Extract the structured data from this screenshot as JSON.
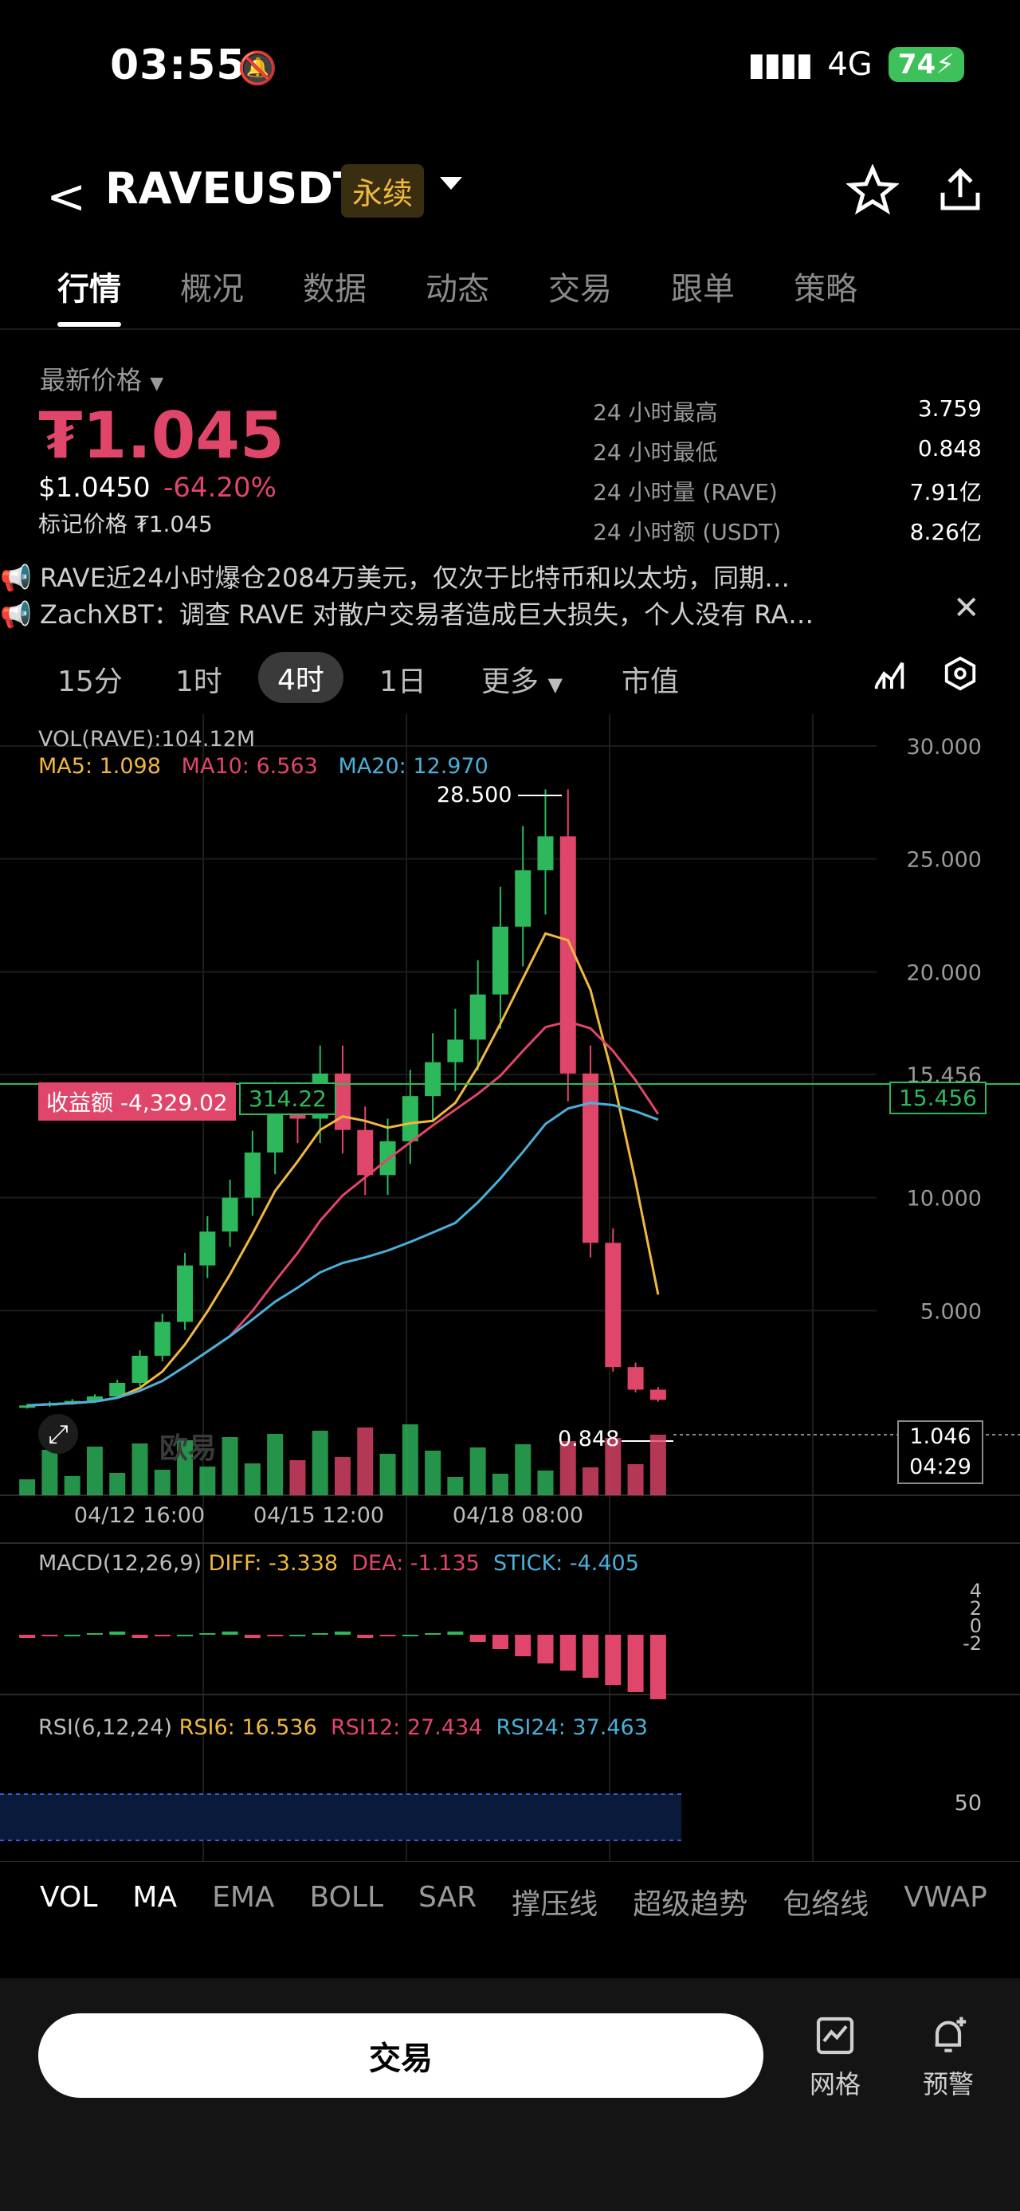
{
  "status": {
    "time": "03:55",
    "network": "4G",
    "battery": "74"
  },
  "header": {
    "symbol": "RAVEUSDT",
    "badge": "永续"
  },
  "tabs": [
    "行情",
    "概况",
    "数据",
    "动态",
    "交易",
    "跟单",
    "策略"
  ],
  "price": {
    "label": "最新价格",
    "last": "₮1.045",
    "usd": "$1.0450",
    "change": "-64.20%",
    "mark": "标记价格 ₮1.045"
  },
  "stats": [
    {
      "k": "24 小时最高",
      "v": "3.759"
    },
    {
      "k": "24 小时最低",
      "v": "0.848"
    },
    {
      "k": "24 小时量 (RAVE)",
      "v": "7.91亿"
    },
    {
      "k": "24 小时额 (USDT)",
      "v": "8.26亿"
    }
  ],
  "news": [
    "RAVE近24小时爆仓2084万美元，仅次于比特币和以太坊，同期…",
    "ZachXBT：调查 RAVE 对散户交易者造成巨大损失，个人没有 RA…"
  ],
  "intervals": [
    "15分",
    "1时",
    "4时",
    "1日",
    "更多",
    "市值"
  ],
  "chart_labels": {
    "vol": "VOL(RAVE):104.12M",
    "ma5": "MA5: 1.098",
    "ma10": "MA10: 6.563",
    "ma20": "MA20: 12.970",
    "high_label": "28.500",
    "low_label": "0.848",
    "pnl": "收益额 -4,329.02",
    "pnl_val": "314.22",
    "entry": "15.456",
    "last_price": "1.046",
    "countdown": "04:29",
    "yticks": [
      "30.000",
      "25.000",
      "20.000",
      "15.456",
      "10.000",
      "5.000"
    ],
    "xticks": [
      "04/12 16:00",
      "04/15 12:00",
      "04/18 08:00"
    ],
    "macd_title": "MACD(12,26,9)",
    "diff": "DIFF: -3.338",
    "dea": "DEA: -1.135",
    "stick": "STICK: -4.405",
    "macd_ticks": [
      "4",
      "2",
      "0",
      "-2"
    ],
    "rsi_title": "RSI(6,12,24)",
    "rsi6": "RSI6: 16.536",
    "rsi12": "RSI12: 27.434",
    "rsi24": "RSI24: 37.463",
    "rsi_tick": "50",
    "watermark": "欧易"
  },
  "chart_data": {
    "type": "candlestick",
    "x": [
      "04/12 16:00",
      "04/15 12:00",
      "04/18 08:00"
    ],
    "ohlc_close_approx": [
      0.8,
      0.9,
      1.0,
      1.2,
      1.8,
      3.0,
      4.5,
      7.0,
      8.5,
      10.0,
      12.0,
      14.0,
      13.5,
      15.5,
      13.0,
      11.0,
      12.5,
      14.5,
      16.0,
      17.0,
      19.0,
      22.0,
      24.5,
      26.0,
      15.5,
      8.0,
      2.5,
      1.5,
      1.05
    ],
    "high": 28.5,
    "low": 0.848,
    "ylim": [
      0,
      30
    ],
    "series": [
      {
        "name": "MA5",
        "value": 1.098,
        "color": "#f0b840"
      },
      {
        "name": "MA10",
        "value": 6.563,
        "color": "#e0466a"
      },
      {
        "name": "MA20",
        "value": 12.97,
        "color": "#4ab0d8"
      }
    ]
  },
  "indicators": [
    "VOL",
    "MA",
    "EMA",
    "BOLL",
    "SAR",
    "撑压线",
    "超级趋势",
    "包络线",
    "VWAP"
  ],
  "bottom": {
    "trade": "交易",
    "grid": "网格",
    "alert": "预警"
  },
  "colors": {
    "up": "#2eb85c",
    "down": "#e0466a",
    "accent": "#f0b840"
  }
}
